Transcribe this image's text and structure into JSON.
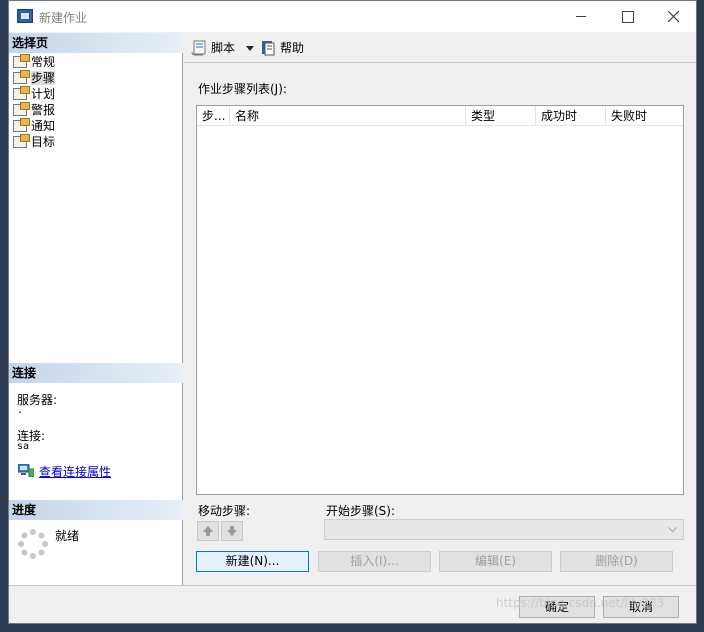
{
  "window": {
    "title": "新建作业"
  },
  "sidebar": {
    "select_header": "选择页",
    "items": [
      {
        "label": "常规"
      },
      {
        "label": "步骤"
      },
      {
        "label": "计划"
      },
      {
        "label": "警报"
      },
      {
        "label": "通知"
      },
      {
        "label": "目标"
      }
    ],
    "selected": "步骤",
    "connection_header": "连接",
    "server_label": "服务器:",
    "server_value": ".",
    "connection_label": "连接:",
    "connection_value": "sa",
    "view_link": "查看连接属性",
    "progress_header": "进度",
    "progress_status": "就绪"
  },
  "toolbar": {
    "script_label": "脚本",
    "help_label": "帮助"
  },
  "main": {
    "steps_list_label": "作业步骤列表(J):",
    "columns": [
      "步...",
      "名称",
      "类型",
      "成功时",
      "失败时"
    ],
    "move_label": "移动步骤:",
    "start_label": "开始步骤(S):",
    "buttons": {
      "new": "新建(N)...",
      "insert": "插入(I)...",
      "edit": "编辑(E)",
      "delete": "删除(D)"
    }
  },
  "footer": {
    "ok": "确定",
    "cancel": "取消"
  },
  "watermark": "https://blog.csdn.net/lily233"
}
